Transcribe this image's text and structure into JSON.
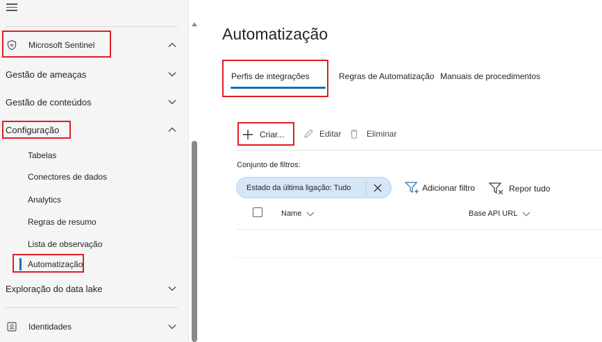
{
  "sidebar": {
    "sections": [
      {
        "label": "Microsoft Sentinel",
        "expanded": true
      },
      {
        "label": "Gestão de ameaças",
        "expanded": false
      },
      {
        "label": "Gestão de conteúdos",
        "expanded": false
      },
      {
        "label": "Configuração",
        "expanded": true
      },
      {
        "label": "Exploração do data lake",
        "expanded": false
      },
      {
        "label": "Identidades",
        "expanded": false
      }
    ],
    "config_items": [
      "Tabelas",
      "Conectores de dados",
      "Analytics",
      "Regras de resumo",
      "Lista de observação",
      "Automatização"
    ],
    "selected_item": "Automatização"
  },
  "main": {
    "title": "Automatização",
    "tabs": [
      {
        "label": "Perfis de integrações",
        "selected": true
      },
      {
        "label": "Regras de Automatização",
        "selected": false
      },
      {
        "label": "Manuais de procedimentos",
        "selected": false
      }
    ],
    "toolbar": {
      "create": "Criar...",
      "edit": "Editar",
      "delete": "Eliminar"
    },
    "filters": {
      "label": "Conjunto de filtros:",
      "pill": "Estado da última ligação: Tudo",
      "add_filter": "Adicionar filtro",
      "reset_all": "Repor tudo"
    },
    "table": {
      "columns": [
        "Name",
        "Base API URL"
      ]
    }
  },
  "colors": {
    "accent": "#0f6cbd",
    "highlight_box": "#e01b24",
    "pill_bg": "#d6e6f7"
  }
}
